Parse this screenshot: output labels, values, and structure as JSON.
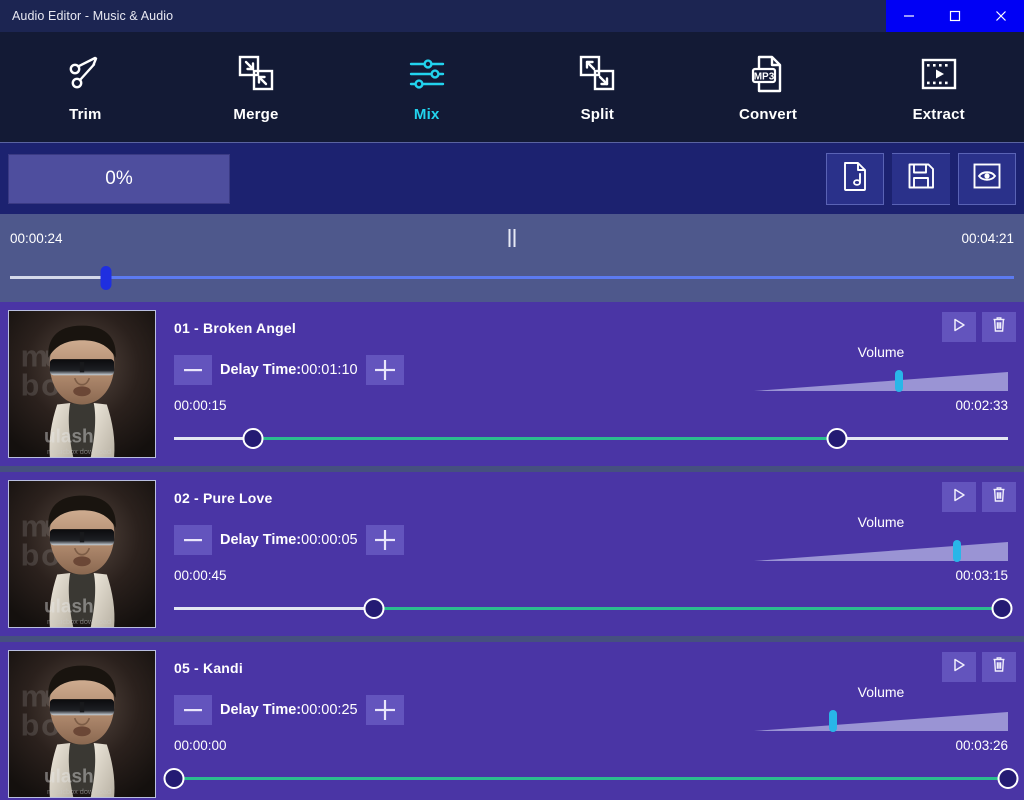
{
  "window": {
    "title": "Audio Editor - Music & Audio",
    "controls": [
      {
        "name": "minimize",
        "glyph": "minimize-icon"
      },
      {
        "name": "maximize",
        "glyph": "maximize-icon"
      },
      {
        "name": "close",
        "glyph": "close-icon"
      }
    ],
    "titlebar_bg": "#1c2552",
    "controls_bg": "#0000f5"
  },
  "toolbar": {
    "accent_color": "#22d3ee",
    "background": "#131a35",
    "items": [
      {
        "label": "Trim",
        "icon": "scissors-icon",
        "active": false
      },
      {
        "label": "Merge",
        "icon": "merge-squares-icon",
        "active": false
      },
      {
        "label": "Mix",
        "icon": "sliders-icon",
        "active": true
      },
      {
        "label": "Split",
        "icon": "split-squares-icon",
        "active": false
      },
      {
        "label": "Convert",
        "icon": "mp3-file-icon",
        "active": false
      },
      {
        "label": "Extract",
        "icon": "film-strip-icon",
        "active": false
      }
    ]
  },
  "progress": {
    "percent_label": "0%",
    "percent_value": 0,
    "buttons": [
      {
        "name": "add-audio-button",
        "icon": "music-file-icon"
      },
      {
        "name": "save-button",
        "icon": "floppy-disk-icon"
      },
      {
        "name": "preview-button",
        "icon": "eye-icon"
      }
    ]
  },
  "master_player": {
    "current_time": "00:00:24",
    "total_time": "00:04:21",
    "transport_icon": "pause-icon",
    "position_percent": 9.6,
    "thumb_color": "#1f2fe0"
  },
  "tracks": [
    {
      "title": "01 - Broken Angel",
      "artwork_alt": "album-artwork",
      "delay_label": "Delay Time:",
      "delay_value": "00:01:10",
      "minus_label": "—",
      "plus_label": "+",
      "volume_label": "Volume",
      "volume_percent": 57,
      "start_time": "00:00:15",
      "end_time": "00:02:33",
      "range_start_percent": 9.5,
      "range_end_percent": 79.5,
      "play_icon": "play-icon",
      "delete_icon": "trash-icon"
    },
    {
      "title": "02 - Pure Love",
      "artwork_alt": "album-artwork",
      "delay_label": "Delay Time:",
      "delay_value": "00:00:05",
      "minus_label": "—",
      "plus_label": "+",
      "volume_label": "Volume",
      "volume_percent": 80,
      "start_time": "00:00:45",
      "end_time": "00:03:15",
      "range_start_percent": 24.0,
      "range_end_percent": 99.3,
      "play_icon": "play-icon",
      "delete_icon": "trash-icon"
    },
    {
      "title": "05 - Kandi",
      "artwork_alt": "album-artwork",
      "delay_label": "Delay Time:",
      "delay_value": "00:00:25",
      "minus_label": "—",
      "plus_label": "+",
      "volume_label": "Volume",
      "volume_percent": 31,
      "start_time": "00:00:00",
      "end_time": "00:03:26",
      "range_start_percent": 0.0,
      "range_end_percent": 100.0,
      "play_icon": "play-icon",
      "delete_icon": "trash-icon"
    }
  ],
  "colors": {
    "track_card": "#4a35a5",
    "app_background": "#46507f",
    "range_fill": "#2bbd8f",
    "volume_thumb": "#29b6e8"
  }
}
